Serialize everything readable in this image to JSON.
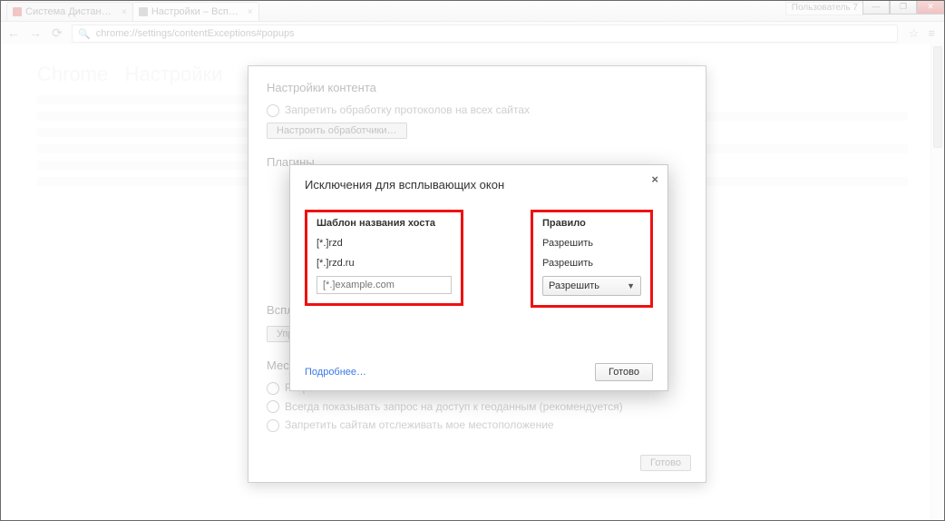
{
  "window": {
    "user_label": "Пользователь 7",
    "controls": {
      "min": "—",
      "max": "❐",
      "close": "✕"
    }
  },
  "tabs": [
    {
      "label": "Система Дистанционно…",
      "active": false
    },
    {
      "label": "Настройки – Всплываю…",
      "active": true
    }
  ],
  "toolbar": {
    "back": "←",
    "fwd": "→",
    "reload": "⟳",
    "url_glyph": "🔍",
    "url": "chrome://settings/contentExceptions#popups",
    "star": "☆",
    "wrench": "≡"
  },
  "bg_panel": {
    "title": "Настройки контента",
    "line1": "Запретить обработку протоколов на всех сайтах",
    "handlers_btn": "Настроить обработчики…",
    "plugins_hdr": "Плагины",
    "popups_hdr": "Всплывающие окна",
    "popups_exc_btn": "Управление исключениями…",
    "loc_hdr": "Местоположение",
    "loc_opt1": "Разрешить всем сайтам отслеживать мое местоположение",
    "loc_opt2": "Всегда показывать запрос на доступ к геоданным (рекомендуется)",
    "loc_opt3": "Запретить сайтам отслеживать мое местоположение",
    "done": "Готово"
  },
  "dialog": {
    "title": "Исключения для всплывающих окон",
    "close": "×",
    "col_host": "Шаблон названия хоста",
    "col_rule": "Правило",
    "rows": [
      {
        "host": "[*.]rzd",
        "rule": "Разрешить"
      },
      {
        "host": "[*.]rzd.ru",
        "rule": "Разрешить"
      }
    ],
    "host_placeholder": "[*.]example.com",
    "rule_select": "Разрешить",
    "learn_more": "Подробнее…",
    "done": "Готово"
  }
}
